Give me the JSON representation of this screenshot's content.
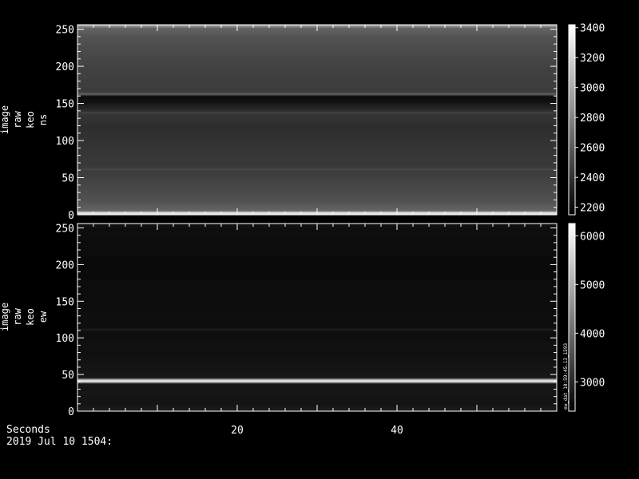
{
  "footer": {
    "x_axis_label": "Seconds",
    "datetime": "2019 Jul 10 1504:"
  },
  "chart_data": [
    {
      "type": "heatmap",
      "ylabel_lines": [
        "image",
        "raw",
        "keo",
        "ns"
      ],
      "x_ticks": [],
      "y_ticks": [
        0,
        50,
        100,
        150,
        200,
        250
      ],
      "ylim": [
        0,
        256
      ],
      "colorbar": {
        "ticks": [
          2200,
          2400,
          2600,
          2800,
          3000,
          3200,
          3400
        ],
        "range": [
          2150,
          3420
        ]
      },
      "row_profile": [
        {
          "y": 0,
          "value": 3150
        },
        {
          "y": 3,
          "value": 3350
        },
        {
          "y": 6,
          "value": 2650
        },
        {
          "y": 20,
          "value": 2550
        },
        {
          "y": 60,
          "value": 2450
        },
        {
          "y": 62,
          "value": 2520
        },
        {
          "y": 64,
          "value": 2440
        },
        {
          "y": 120,
          "value": 2380
        },
        {
          "y": 137,
          "value": 2420
        },
        {
          "y": 138,
          "value": 2520
        },
        {
          "y": 140,
          "value": 2380
        },
        {
          "y": 152,
          "value": 2250
        },
        {
          "y": 160,
          "value": 2200
        },
        {
          "y": 163,
          "value": 2650
        },
        {
          "y": 166,
          "value": 2450
        },
        {
          "y": 200,
          "value": 2480
        },
        {
          "y": 240,
          "value": 2560
        },
        {
          "y": 252,
          "value": 2650
        },
        {
          "y": 256,
          "value": 3000
        }
      ]
    },
    {
      "type": "heatmap",
      "ylabel_lines": [
        "image",
        "raw",
        "keo",
        "ew"
      ],
      "x_ticks": [
        20,
        40
      ],
      "xlim": [
        0,
        60
      ],
      "y_ticks": [
        0,
        50,
        100,
        150,
        200,
        250
      ],
      "ylim": [
        0,
        256
      ],
      "colorbar": {
        "ticks": [
          3000,
          4000,
          5000,
          6000
        ],
        "range": [
          2400,
          6250
        ],
        "vertical_note": "ew_dat_10:59:45.13_1593"
      },
      "row_profile": [
        {
          "y": 0,
          "value": 2850
        },
        {
          "y": 4,
          "value": 2800
        },
        {
          "y": 8,
          "value": 2700
        },
        {
          "y": 38,
          "value": 2750
        },
        {
          "y": 41,
          "value": 6000
        },
        {
          "y": 43,
          "value": 5600
        },
        {
          "y": 46,
          "value": 2750
        },
        {
          "y": 80,
          "value": 2650
        },
        {
          "y": 110,
          "value": 2620
        },
        {
          "y": 112,
          "value": 2900
        },
        {
          "y": 114,
          "value": 2620
        },
        {
          "y": 200,
          "value": 2560
        },
        {
          "y": 250,
          "value": 2620
        },
        {
          "y": 256,
          "value": 2700
        }
      ]
    }
  ]
}
